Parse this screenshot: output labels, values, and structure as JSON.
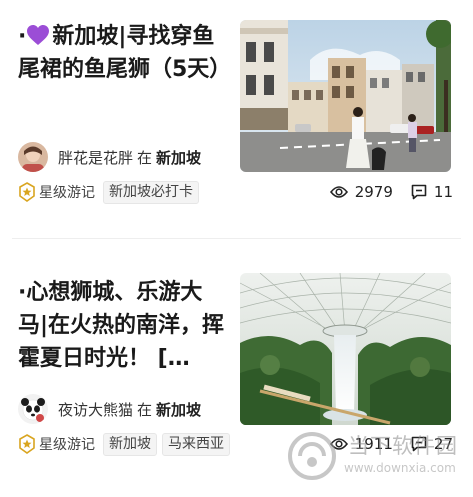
{
  "posts": [
    {
      "title": "·💜新加坡|寻找穿鱼尾裙的鱼尾狮（5天）",
      "title_prefix": "·",
      "title_text": "新加坡|寻找穿鱼尾裙的鱼尾狮（5天）",
      "heart_emoji": "purple-heart",
      "author": "胖花是花胖",
      "at_label": "在",
      "location": "新加坡",
      "badge_label": "星级游记",
      "tags": [
        "新加坡必打卡"
      ],
      "views": "2979",
      "comments": "11",
      "thumbnail": "street-scene-photo"
    },
    {
      "title": "·心想狮城、乐游大马|在火热的南洋，挥霍夏日时光！ […",
      "author": "夜访大熊猫",
      "at_label": "在",
      "location": "新加坡",
      "badge_label": "星级游记",
      "tags": [
        "新加坡",
        "马来西亚"
      ],
      "views": "1911",
      "comments": "27",
      "thumbnail": "jewel-waterfall-photo"
    }
  ],
  "watermark": {
    "text": "当下软件园",
    "url": "www.downxia.com"
  },
  "colors": {
    "purple_heart": "#9b4dd6",
    "badge_gold": "#d9a520",
    "tag_bg": "#f4f4f4",
    "divider": "#eeeeee"
  }
}
